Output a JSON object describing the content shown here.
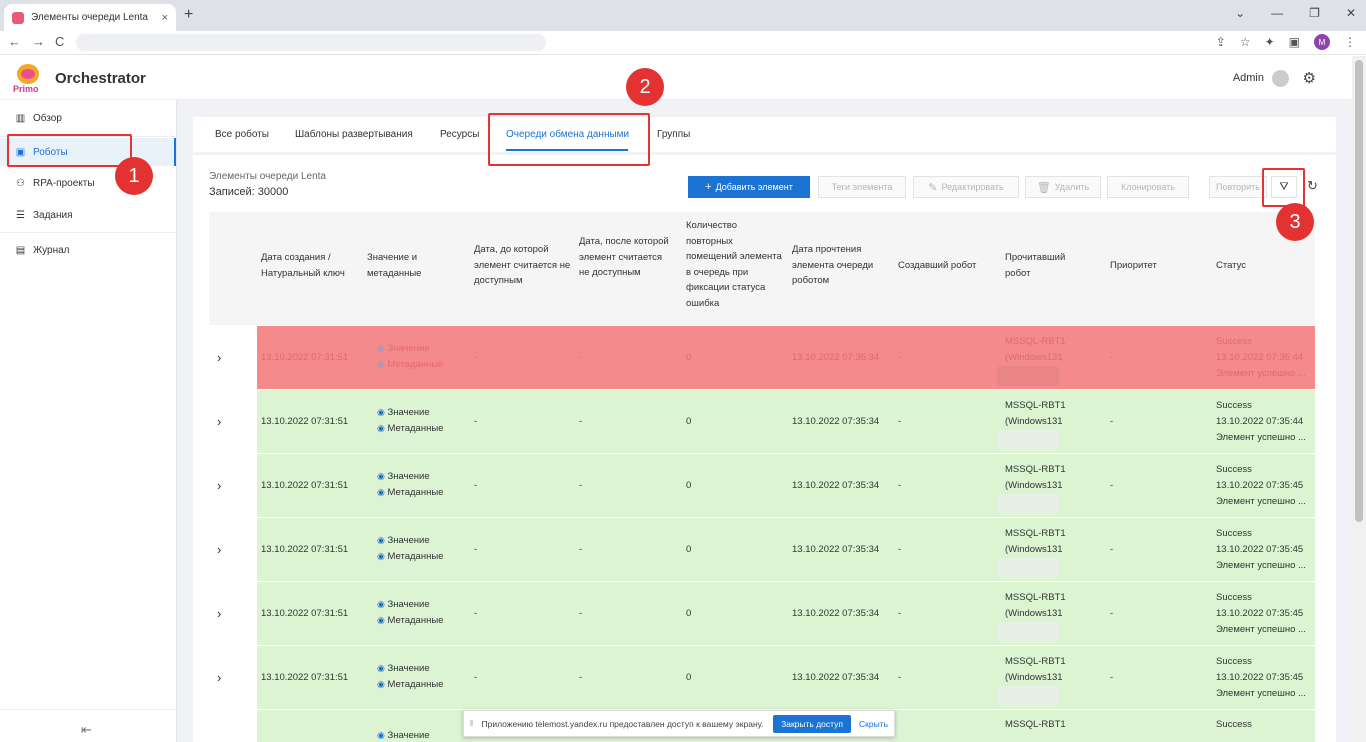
{
  "browser": {
    "tab_title": "Элементы очереди Lenta",
    "tab_close": "×",
    "new_tab": "+",
    "controls": [
      "⌄",
      "—",
      "❐",
      "✕"
    ],
    "back": "←",
    "forward": "→",
    "reload": "C",
    "profile_initial": "M"
  },
  "app": {
    "logo_text": "Primo",
    "title": "Orchestrator",
    "user": "Admin"
  },
  "sidebar": {
    "items": [
      {
        "label": "Обзор",
        "icon": "chart-icon"
      },
      {
        "label": "Роботы",
        "icon": "robot-icon"
      },
      {
        "label": "RPA-проекты",
        "icon": "tree-icon"
      },
      {
        "label": "Задания",
        "icon": "list-icon"
      },
      {
        "label": "Журнал",
        "icon": "journal-icon"
      }
    ]
  },
  "tabs": [
    "Все роботы",
    "Шаблоны развертывания",
    "Ресурсы",
    "Очереди обмена данными",
    "Группы"
  ],
  "queue": {
    "title": "Элементы очереди Lenta",
    "records": "Записей: 30000"
  },
  "toolbar": {
    "add": "Добавить элемент",
    "tags": "Теги элемента",
    "edit": "Редактировать",
    "delete": "Удалить",
    "clone": "Клонировать",
    "retry": "Повторить"
  },
  "columns": [
    "Дата создания / Натуральный ключ",
    "Значение и метаданные",
    "Дата, до которой элемент считается не доступным",
    "Дата, после которой элемент считается не доступным",
    "Количество повторных помещений элемента в очередь при фиксации статуса ошибка",
    "Дата прочтения элемента очереди роботом",
    "Создавший робот",
    "Прочитавший робот",
    "Приоритет",
    "Статус"
  ],
  "rows": [
    {
      "state": "error",
      "created": "13.10.2022 07:31:51",
      "value": "Значение",
      "meta": "Метаданные",
      "before": "-",
      "after": "-",
      "count": "0",
      "read": "13.10.2022 07:35:34",
      "creator": "-",
      "reader1": "MSSQL-RBT1",
      "reader2": "(Windows131",
      "priority": "-",
      "status": "Success",
      "status_time": "13.10.2022 07:35:44",
      "status_msg": "Элемент успешно ..."
    },
    {
      "state": "ok",
      "created": "13.10.2022 07:31:51",
      "value": "Значение",
      "meta": "Метаданные",
      "before": "-",
      "after": "-",
      "count": "0",
      "read": "13.10.2022 07:35:34",
      "creator": "-",
      "reader1": "MSSQL-RBT1",
      "reader2": "(Windows131",
      "priority": "-",
      "status": "Success",
      "status_time": "13.10.2022 07:35:44",
      "status_msg": "Элемент успешно ..."
    },
    {
      "state": "ok",
      "created": "13.10.2022 07:31:51",
      "value": "Значение",
      "meta": "Метаданные",
      "before": "-",
      "after": "-",
      "count": "0",
      "read": "13.10.2022 07:35:34",
      "creator": "-",
      "reader1": "MSSQL-RBT1",
      "reader2": "(Windows131",
      "priority": "-",
      "status": "Success",
      "status_time": "13.10.2022 07:35:45",
      "status_msg": "Элемент успешно ..."
    },
    {
      "state": "ok",
      "created": "13.10.2022 07:31:51",
      "value": "Значение",
      "meta": "Метаданные",
      "before": "-",
      "after": "-",
      "count": "0",
      "read": "13.10.2022 07:35:34",
      "creator": "-",
      "reader1": "MSSQL-RBT1",
      "reader2": "(Windows131",
      "priority": "-",
      "status": "Success",
      "status_time": "13.10.2022 07:35:45",
      "status_msg": "Элемент успешно ..."
    },
    {
      "state": "ok",
      "created": "13.10.2022 07:31:51",
      "value": "Значение",
      "meta": "Метаданные",
      "before": "-",
      "after": "-",
      "count": "0",
      "read": "13.10.2022 07:35:34",
      "creator": "-",
      "reader1": "MSSQL-RBT1",
      "reader2": "(Windows131",
      "priority": "-",
      "status": "Success",
      "status_time": "13.10.2022 07:35:45",
      "status_msg": "Элемент успешно ..."
    },
    {
      "state": "ok",
      "created": "13.10.2022 07:31:51",
      "value": "Значение",
      "meta": "Метаданные",
      "before": "-",
      "after": "-",
      "count": "0",
      "read": "13.10.2022 07:35:34",
      "creator": "-",
      "reader1": "MSSQL-RBT1",
      "reader2": "(Windows131",
      "priority": "-",
      "status": "Success",
      "status_time": "13.10.2022 07:35:45",
      "status_msg": "Элемент успешно ..."
    },
    {
      "state": "ok",
      "created": "",
      "value": "Значение",
      "meta": "",
      "before": "",
      "after": "",
      "count": "",
      "read": "",
      "creator": "",
      "reader1": "MSSQL-RBT1",
      "reader2": "",
      "priority": "",
      "status": "Success",
      "status_time": "",
      "status_msg": ""
    }
  ],
  "annotations": [
    "1",
    "2",
    "3"
  ],
  "sharebar": {
    "text": "Приложению telemost.yandex.ru предоставлен доступ к вашему экрану.",
    "stop": "Закрыть доступ",
    "hide": "Скрыть"
  },
  "colors": {
    "accent": "#1b73d3",
    "error_row": "#f48a8a",
    "ok_row": "#dcf4d2",
    "annotation": "#e33333"
  }
}
